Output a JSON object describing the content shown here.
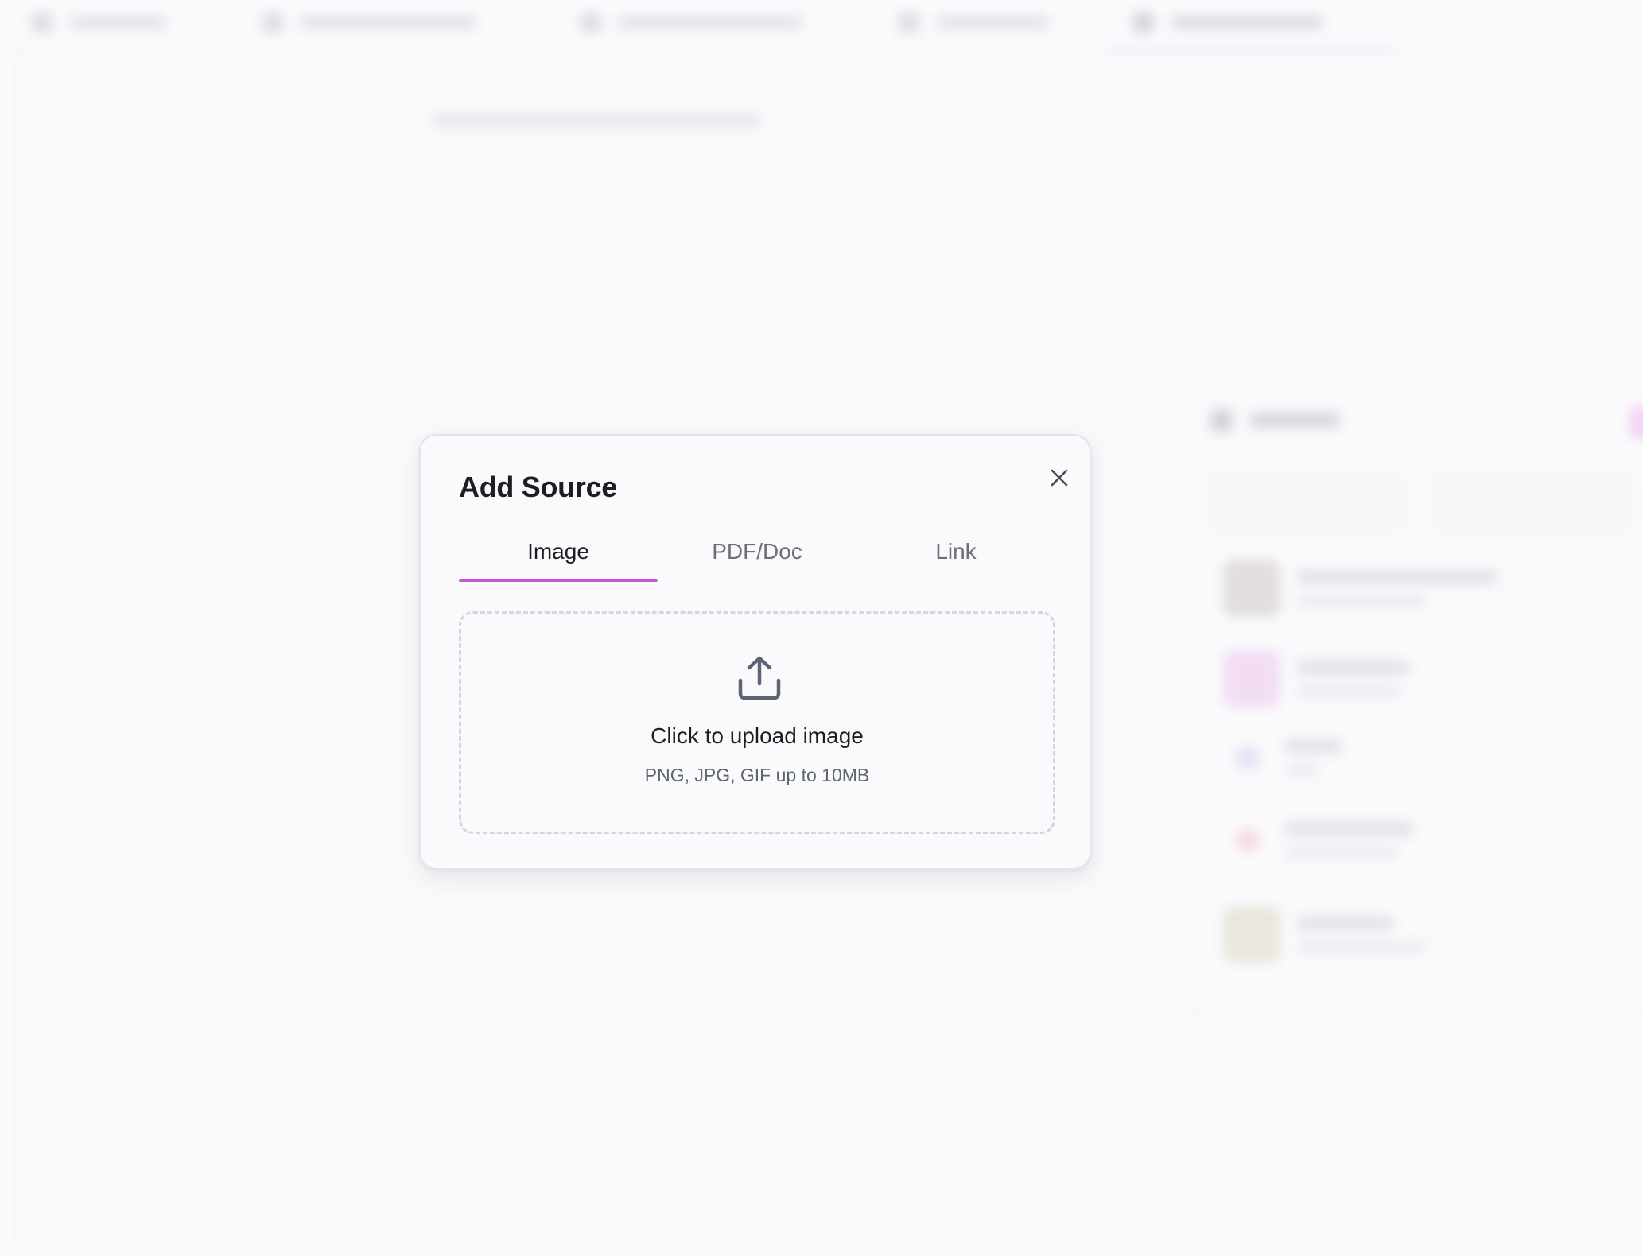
{
  "colors": {
    "accent": "#c659d1",
    "page_background": "#fafafc",
    "modal_border": "#e3e3ea",
    "dropzone_border": "#d5d5dd",
    "icon_gray": "#5c6575",
    "title_text": "#1e1e22"
  },
  "modal": {
    "title": "Add Source",
    "close_icon": "close-icon",
    "tabs": [
      {
        "label": "Image",
        "active": true
      },
      {
        "label": "PDF/Doc",
        "active": false
      },
      {
        "label": "Link",
        "active": false
      }
    ],
    "dropzone": {
      "icon": "upload-icon",
      "label": "Click to upload image",
      "hint": "PNG, JPG, GIF up to 10MB"
    }
  }
}
